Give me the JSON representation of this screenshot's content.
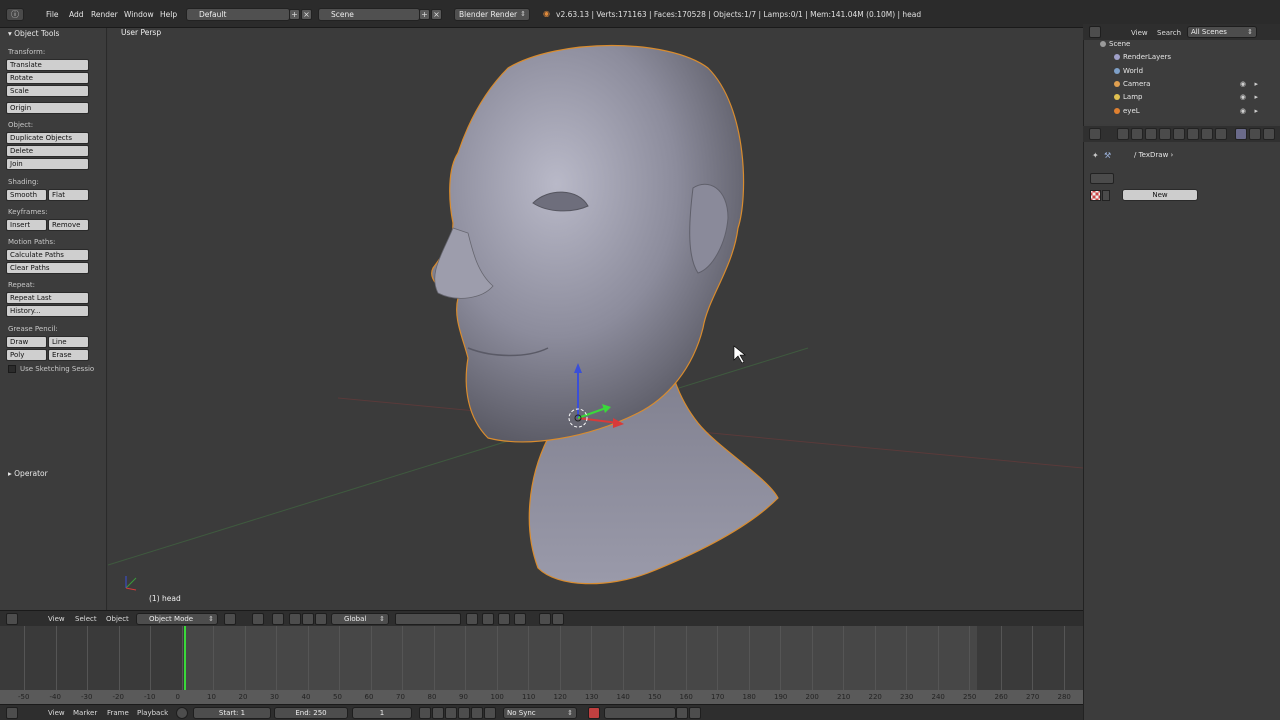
{
  "topbar": {
    "menus": [
      "File",
      "Add",
      "Render",
      "Window",
      "Help"
    ],
    "screen_layout": "Default",
    "scene": "Scene",
    "render_engine": "Blender Render",
    "stats": "v2.63.13 | Verts:171163 | Faces:170528 | Objects:1/7 | Lamps:0/1 | Mem:141.04M (0.10M) | head"
  },
  "toolshelf": {
    "title": "Object Tools",
    "sections": {
      "transform": "Transform:",
      "object": "Object:",
      "shading": "Shading:",
      "keyframes": "Keyframes:",
      "motion_paths": "Motion Paths:",
      "repeat": "Repeat:",
      "grease_pencil": "Grease Pencil:"
    },
    "buttons": {
      "translate": "Translate",
      "rotate": "Rotate",
      "scale": "Scale",
      "origin": "Origin",
      "duplicate": "Duplicate Objects",
      "delete": "Delete",
      "join": "Join",
      "smooth": "Smooth",
      "flat": "Flat",
      "insert": "Insert",
      "remove": "Remove",
      "calc_paths": "Calculate Paths",
      "clear_paths": "Clear Paths",
      "repeat_last": "Repeat Last",
      "history": "History...",
      "draw": "Draw",
      "line": "Line",
      "poly": "Poly",
      "erase": "Erase"
    },
    "use_sketching": "Use Sketching Sessio",
    "operator_title": "Operator"
  },
  "viewport": {
    "view_label": "User Persp",
    "object_label": "(1) head"
  },
  "view3d_header": {
    "menus": [
      "View",
      "Select",
      "Object"
    ],
    "mode": "Object Mode",
    "orientation": "Global"
  },
  "timeline": {
    "ticks": [
      "-50",
      "-40",
      "-30",
      "-20",
      "-10",
      "0",
      "10",
      "20",
      "30",
      "40",
      "50",
      "60",
      "70",
      "80",
      "90",
      "100",
      "110",
      "120",
      "130",
      "140",
      "150",
      "160",
      "170",
      "180",
      "190",
      "200",
      "210",
      "220",
      "230",
      "240",
      "250",
      "260",
      "270",
      "280"
    ],
    "menus": [
      "View",
      "Marker",
      "Frame",
      "Playback"
    ],
    "start": "Start: 1",
    "end": "End: 250",
    "current_frame": "1",
    "sync": "No Sync"
  },
  "outliner": {
    "menus": [
      "View",
      "Search"
    ],
    "filter": "All Scenes",
    "rows": [
      {
        "label": "Scene",
        "color": "#9a9a9a"
      },
      {
        "label": "RenderLayers",
        "color": "#a0a0c8"
      },
      {
        "label": "World",
        "color": "#7ea0c8"
      },
      {
        "label": "Camera",
        "color": "#e0a050"
      },
      {
        "label": "Lamp",
        "color": "#e0c050"
      },
      {
        "label": "eyeL",
        "color": "#e08030"
      }
    ]
  },
  "properties": {
    "texture_name": "TexDraw",
    "new_button": "New"
  }
}
